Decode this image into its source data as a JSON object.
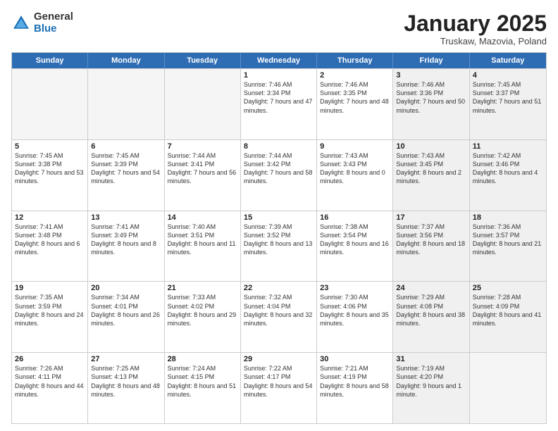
{
  "logo": {
    "general": "General",
    "blue": "Blue"
  },
  "header": {
    "month": "January 2025",
    "location": "Truskaw, Mazovia, Poland"
  },
  "weekdays": [
    "Sunday",
    "Monday",
    "Tuesday",
    "Wednesday",
    "Thursday",
    "Friday",
    "Saturday"
  ],
  "weeks": [
    [
      {
        "day": "",
        "sunrise": "",
        "sunset": "",
        "daylight": "",
        "shaded": true
      },
      {
        "day": "",
        "sunrise": "",
        "sunset": "",
        "daylight": "",
        "shaded": true
      },
      {
        "day": "",
        "sunrise": "",
        "sunset": "",
        "daylight": "",
        "shaded": true
      },
      {
        "day": "1",
        "sunrise": "Sunrise: 7:46 AM",
        "sunset": "Sunset: 3:34 PM",
        "daylight": "Daylight: 7 hours and 47 minutes.",
        "shaded": false
      },
      {
        "day": "2",
        "sunrise": "Sunrise: 7:46 AM",
        "sunset": "Sunset: 3:35 PM",
        "daylight": "Daylight: 7 hours and 48 minutes.",
        "shaded": false
      },
      {
        "day": "3",
        "sunrise": "Sunrise: 7:46 AM",
        "sunset": "Sunset: 3:36 PM",
        "daylight": "Daylight: 7 hours and 50 minutes.",
        "shaded": true
      },
      {
        "day": "4",
        "sunrise": "Sunrise: 7:45 AM",
        "sunset": "Sunset: 3:37 PM",
        "daylight": "Daylight: 7 hours and 51 minutes.",
        "shaded": true
      }
    ],
    [
      {
        "day": "5",
        "sunrise": "Sunrise: 7:45 AM",
        "sunset": "Sunset: 3:38 PM",
        "daylight": "Daylight: 7 hours and 53 minutes.",
        "shaded": false
      },
      {
        "day": "6",
        "sunrise": "Sunrise: 7:45 AM",
        "sunset": "Sunset: 3:39 PM",
        "daylight": "Daylight: 7 hours and 54 minutes.",
        "shaded": false
      },
      {
        "day": "7",
        "sunrise": "Sunrise: 7:44 AM",
        "sunset": "Sunset: 3:41 PM",
        "daylight": "Daylight: 7 hours and 56 minutes.",
        "shaded": false
      },
      {
        "day": "8",
        "sunrise": "Sunrise: 7:44 AM",
        "sunset": "Sunset: 3:42 PM",
        "daylight": "Daylight: 7 hours and 58 minutes.",
        "shaded": false
      },
      {
        "day": "9",
        "sunrise": "Sunrise: 7:43 AM",
        "sunset": "Sunset: 3:43 PM",
        "daylight": "Daylight: 8 hours and 0 minutes.",
        "shaded": false
      },
      {
        "day": "10",
        "sunrise": "Sunrise: 7:43 AM",
        "sunset": "Sunset: 3:45 PM",
        "daylight": "Daylight: 8 hours and 2 minutes.",
        "shaded": true
      },
      {
        "day": "11",
        "sunrise": "Sunrise: 7:42 AM",
        "sunset": "Sunset: 3:46 PM",
        "daylight": "Daylight: 8 hours and 4 minutes.",
        "shaded": true
      }
    ],
    [
      {
        "day": "12",
        "sunrise": "Sunrise: 7:41 AM",
        "sunset": "Sunset: 3:48 PM",
        "daylight": "Daylight: 8 hours and 6 minutes.",
        "shaded": false
      },
      {
        "day": "13",
        "sunrise": "Sunrise: 7:41 AM",
        "sunset": "Sunset: 3:49 PM",
        "daylight": "Daylight: 8 hours and 8 minutes.",
        "shaded": false
      },
      {
        "day": "14",
        "sunrise": "Sunrise: 7:40 AM",
        "sunset": "Sunset: 3:51 PM",
        "daylight": "Daylight: 8 hours and 11 minutes.",
        "shaded": false
      },
      {
        "day": "15",
        "sunrise": "Sunrise: 7:39 AM",
        "sunset": "Sunset: 3:52 PM",
        "daylight": "Daylight: 8 hours and 13 minutes.",
        "shaded": false
      },
      {
        "day": "16",
        "sunrise": "Sunrise: 7:38 AM",
        "sunset": "Sunset: 3:54 PM",
        "daylight": "Daylight: 8 hours and 16 minutes.",
        "shaded": false
      },
      {
        "day": "17",
        "sunrise": "Sunrise: 7:37 AM",
        "sunset": "Sunset: 3:56 PM",
        "daylight": "Daylight: 8 hours and 18 minutes.",
        "shaded": true
      },
      {
        "day": "18",
        "sunrise": "Sunrise: 7:36 AM",
        "sunset": "Sunset: 3:57 PM",
        "daylight": "Daylight: 8 hours and 21 minutes.",
        "shaded": true
      }
    ],
    [
      {
        "day": "19",
        "sunrise": "Sunrise: 7:35 AM",
        "sunset": "Sunset: 3:59 PM",
        "daylight": "Daylight: 8 hours and 24 minutes.",
        "shaded": false
      },
      {
        "day": "20",
        "sunrise": "Sunrise: 7:34 AM",
        "sunset": "Sunset: 4:01 PM",
        "daylight": "Daylight: 8 hours and 26 minutes.",
        "shaded": false
      },
      {
        "day": "21",
        "sunrise": "Sunrise: 7:33 AM",
        "sunset": "Sunset: 4:02 PM",
        "daylight": "Daylight: 8 hours and 29 minutes.",
        "shaded": false
      },
      {
        "day": "22",
        "sunrise": "Sunrise: 7:32 AM",
        "sunset": "Sunset: 4:04 PM",
        "daylight": "Daylight: 8 hours and 32 minutes.",
        "shaded": false
      },
      {
        "day": "23",
        "sunrise": "Sunrise: 7:30 AM",
        "sunset": "Sunset: 4:06 PM",
        "daylight": "Daylight: 8 hours and 35 minutes.",
        "shaded": false
      },
      {
        "day": "24",
        "sunrise": "Sunrise: 7:29 AM",
        "sunset": "Sunset: 4:08 PM",
        "daylight": "Daylight: 8 hours and 38 minutes.",
        "shaded": true
      },
      {
        "day": "25",
        "sunrise": "Sunrise: 7:28 AM",
        "sunset": "Sunset: 4:09 PM",
        "daylight": "Daylight: 8 hours and 41 minutes.",
        "shaded": true
      }
    ],
    [
      {
        "day": "26",
        "sunrise": "Sunrise: 7:26 AM",
        "sunset": "Sunset: 4:11 PM",
        "daylight": "Daylight: 8 hours and 44 minutes.",
        "shaded": false
      },
      {
        "day": "27",
        "sunrise": "Sunrise: 7:25 AM",
        "sunset": "Sunset: 4:13 PM",
        "daylight": "Daylight: 8 hours and 48 minutes.",
        "shaded": false
      },
      {
        "day": "28",
        "sunrise": "Sunrise: 7:24 AM",
        "sunset": "Sunset: 4:15 PM",
        "daylight": "Daylight: 8 hours and 51 minutes.",
        "shaded": false
      },
      {
        "day": "29",
        "sunrise": "Sunrise: 7:22 AM",
        "sunset": "Sunset: 4:17 PM",
        "daylight": "Daylight: 8 hours and 54 minutes.",
        "shaded": false
      },
      {
        "day": "30",
        "sunrise": "Sunrise: 7:21 AM",
        "sunset": "Sunset: 4:19 PM",
        "daylight": "Daylight: 8 hours and 58 minutes.",
        "shaded": false
      },
      {
        "day": "31",
        "sunrise": "Sunrise: 7:19 AM",
        "sunset": "Sunset: 4:20 PM",
        "daylight": "Daylight: 9 hours and 1 minute.",
        "shaded": true
      },
      {
        "day": "",
        "sunrise": "",
        "sunset": "",
        "daylight": "",
        "shaded": true
      }
    ]
  ]
}
